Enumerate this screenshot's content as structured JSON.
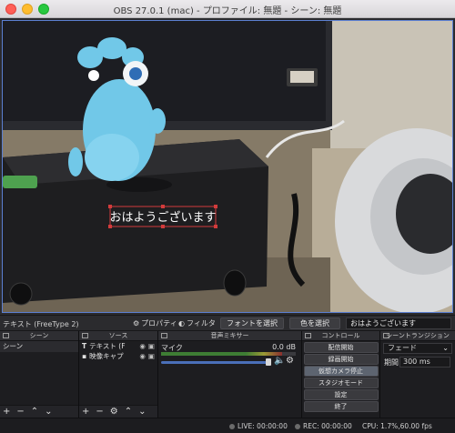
{
  "window": {
    "title": "OBS 27.0.1 (mac) - プロファイル: 無題 - シーン: 無題"
  },
  "preview": {
    "overlay_text": "おはようございます"
  },
  "toolbar": {
    "source_name": "テキスト (FreeType 2)",
    "properties_label": "プロパティ",
    "filters_label": "フィルタ",
    "font_button": "フォントを選択",
    "color_button": "色を選択",
    "text_value": "おはようございます"
  },
  "docks": {
    "scenes": {
      "title": "シーン",
      "items": [
        "シーン"
      ]
    },
    "sources": {
      "title": "ソース",
      "items": [
        {
          "label": "テキスト (F",
          "icon": "text-icon"
        },
        {
          "label": "映像キャプ",
          "icon": "camera-icon"
        }
      ]
    },
    "mixer": {
      "title": "音声ミキサー",
      "channel": "マイク",
      "db": "0.0 dB",
      "level": 0.9
    },
    "controls": {
      "title": "コントロール",
      "buttons": [
        "配信開始",
        "録画開始",
        "仮想カメラ停止",
        "スタジオモード",
        "設定",
        "終了"
      ]
    },
    "transitions": {
      "title": "シーントランジション",
      "selected": "フェード",
      "duration_label": "期間",
      "duration_value": "300 ms"
    }
  },
  "status": {
    "live": "LIVE: 00:00:00",
    "rec": "REC: 00:00:00",
    "cpu": "CPU: 1.7%,60.00 fps"
  }
}
